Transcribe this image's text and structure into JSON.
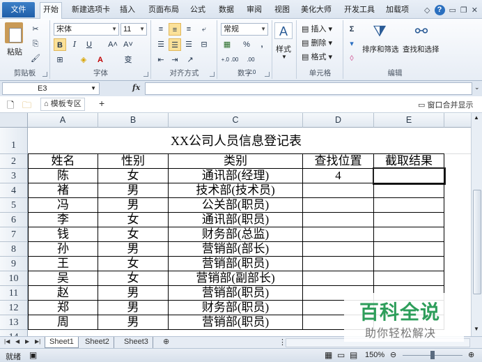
{
  "tabs": {
    "file": "文件",
    "items": [
      "开始",
      "新建选项卡",
      "插入",
      "页面布局",
      "公式",
      "数据",
      "审阅",
      "视图",
      "美化大师",
      "开发工具",
      "加载项"
    ],
    "active": "开始"
  },
  "ribbon": {
    "clipboard": {
      "label": "剪贴板",
      "paste": "粘贴"
    },
    "font": {
      "label": "字体",
      "name": "宋体",
      "size": "11",
      "bold": "B",
      "italic": "I",
      "underline": "U",
      "grow": "A˄",
      "shrink": "A˅",
      "phonetic": "变"
    },
    "alignment": {
      "label": "对齐方式"
    },
    "number": {
      "label": "数字",
      "format": "常规",
      "percent": "%",
      "comma": ",",
      "inc_decimal": "+.0 .00",
      "dec_decimal": ".00 →.0"
    },
    "styles": {
      "label": "样式"
    },
    "cells": {
      "label": "单元格",
      "insert": "插入",
      "delete": "删除",
      "format": "格式"
    },
    "editing": {
      "label": "编辑",
      "sum": "Σ",
      "sort_filter": "排序和筛选",
      "find_select": "查找和选择"
    }
  },
  "formula_bar": {
    "name_box": "E3",
    "fx": "fx",
    "formula": ""
  },
  "doc_bar": {
    "template_zone": "模板专区",
    "add": "+",
    "window_merge": "窗口合并显示"
  },
  "sheet": {
    "columns": [
      "A",
      "B",
      "C",
      "D",
      "E"
    ],
    "rows": [
      "1",
      "2",
      "3",
      "4",
      "5",
      "6",
      "7",
      "8",
      "9",
      "10",
      "11",
      "12",
      "13",
      "14"
    ],
    "title": "XX公司人员信息登记表",
    "headers": [
      "姓名",
      "性别",
      "类别",
      "查找位置",
      "截取结果"
    ],
    "data": [
      [
        "陈",
        "女",
        "通讯部(经理)",
        "4",
        ""
      ],
      [
        "褚",
        "男",
        "技术部(技术员)",
        "",
        ""
      ],
      [
        "冯",
        "男",
        "公关部(职员)",
        "",
        ""
      ],
      [
        "李",
        "女",
        "通讯部(职员)",
        "",
        ""
      ],
      [
        "钱",
        "女",
        "财务部(总监)",
        "",
        ""
      ],
      [
        "孙",
        "男",
        "营销部(部长)",
        "",
        ""
      ],
      [
        "王",
        "女",
        "营销部(职员)",
        "",
        ""
      ],
      [
        "吴",
        "女",
        "营销部(副部长)",
        "",
        ""
      ],
      [
        "赵",
        "男",
        "营销部(职员)",
        "",
        ""
      ],
      [
        "郑",
        "男",
        "财务部(职员)",
        "",
        ""
      ],
      [
        "周",
        "男",
        "营销部(职员)",
        "",
        ""
      ]
    ]
  },
  "sheet_tabs": [
    "Sheet1",
    "Sheet2",
    "Sheet3"
  ],
  "active_sheet": "Sheet1",
  "status": {
    "ready": "就绪",
    "zoom": "150%"
  },
  "watermark": {
    "title": "百科全说",
    "subtitle": "助你轻松解决"
  }
}
